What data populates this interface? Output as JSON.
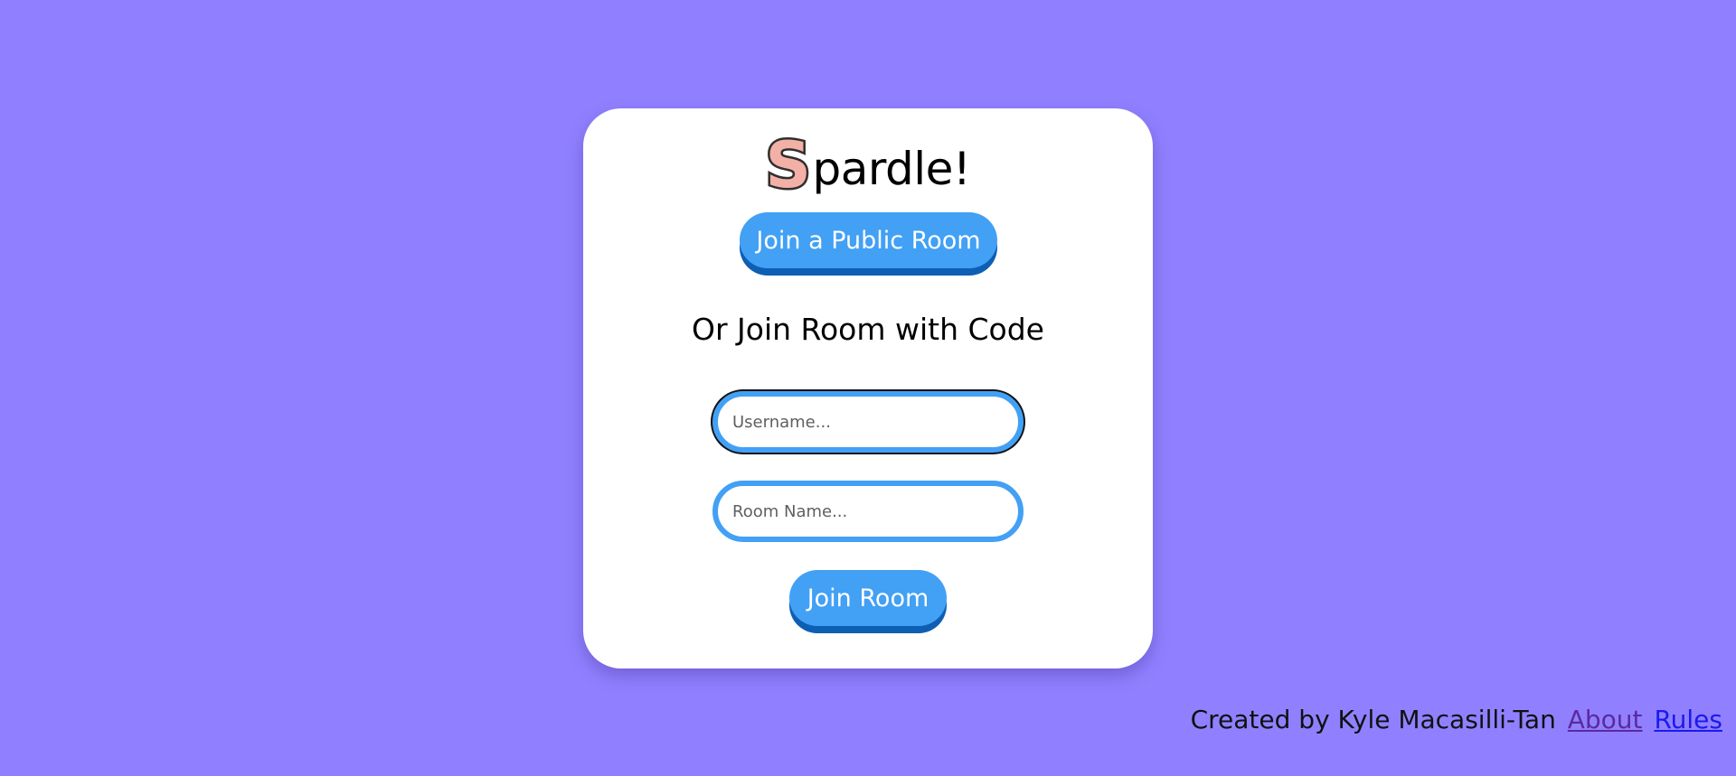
{
  "logo": {
    "initial": "S",
    "rest": "pardle!"
  },
  "card": {
    "public_room_button": "Join a Public Room",
    "subheading": "Or Join Room with Code",
    "username_placeholder": "Username...",
    "room_name_placeholder": "Room Name...",
    "join_room_button": "Join Room"
  },
  "footer": {
    "credit": "Created by Kyle Macasilli-Tan",
    "about_link": "About",
    "rules_link": "Rules"
  },
  "colors": {
    "background": "#9080ff",
    "card": "#ffffff",
    "button": "#42a0f5",
    "button_shadow": "#0d5fb3",
    "logo_s_fill": "#f2b0a6"
  }
}
